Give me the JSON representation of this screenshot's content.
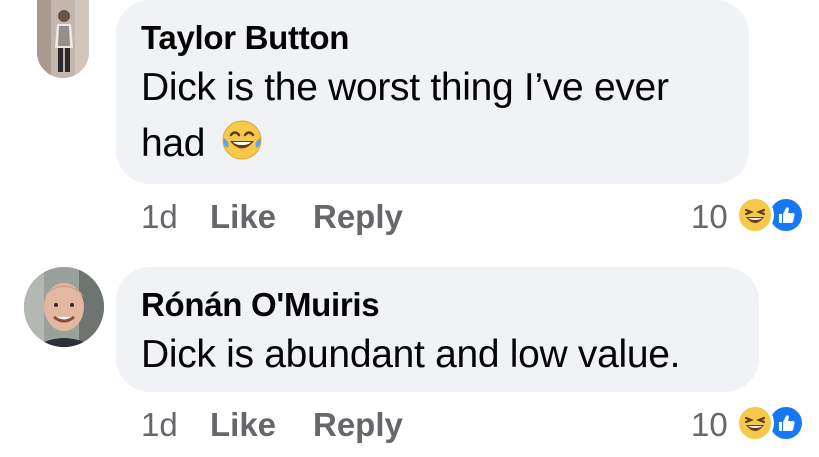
{
  "comments": [
    {
      "author": "Taylor Button",
      "text": "Dick is the worst thing I’ve ever had",
      "emoji": "😂",
      "time": "1d",
      "like_label": "Like",
      "reply_label": "Reply",
      "reaction_count": "10",
      "reactions": [
        "haha-icon",
        "like-icon"
      ]
    },
    {
      "author": "Rónán O'Muiris",
      "text": "Dick is abundant and low value.",
      "time": "1d",
      "like_label": "Like",
      "reply_label": "Reply",
      "reaction_count": "10",
      "reactions": [
        "haha-icon",
        "like-icon"
      ]
    }
  ],
  "colors": {
    "bubble": "#f0f2f5",
    "secondary_text": "#65676b",
    "like_blue": "#1877f2",
    "haha_yellow": "#f7c94b"
  }
}
